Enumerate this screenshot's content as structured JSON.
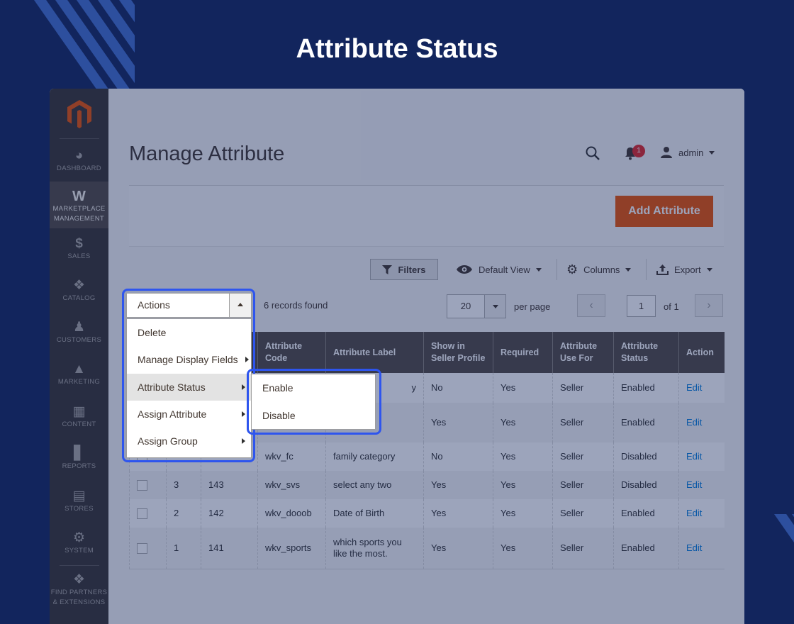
{
  "headline": "Attribute Status",
  "sidebar": {
    "items": [
      {
        "icon": "dashboard-icon",
        "label1": "DASHBOARD",
        "label2": ""
      },
      {
        "icon": "marketplace-icon",
        "label1": "MARKETPLACE",
        "label2": "MANAGEMENT"
      },
      {
        "icon": "sales-icon",
        "label1": "SALES",
        "label2": ""
      },
      {
        "icon": "catalog-icon",
        "label1": "CATALOG",
        "label2": ""
      },
      {
        "icon": "customers-icon",
        "label1": "CUSTOMERS",
        "label2": ""
      },
      {
        "icon": "marketing-icon",
        "label1": "MARKETING",
        "label2": ""
      },
      {
        "icon": "content-icon",
        "label1": "CONTENT",
        "label2": ""
      },
      {
        "icon": "reports-icon",
        "label1": "REPORTS",
        "label2": ""
      },
      {
        "icon": "stores-icon",
        "label1": "STORES",
        "label2": ""
      },
      {
        "icon": "system-icon",
        "label1": "SYSTEM",
        "label2": ""
      },
      {
        "icon": "partners-icon",
        "label1": "FIND PARTNERS",
        "label2": "& EXTENSIONS"
      }
    ]
  },
  "header": {
    "title": "Manage Attribute",
    "notification_count": "1",
    "user": "admin"
  },
  "action_bar": {
    "add_label": "Add Attribute"
  },
  "toolbar": {
    "filters": "Filters",
    "default_view": "Default View",
    "columns": "Columns",
    "export": "Export"
  },
  "grid_controls": {
    "records": "6 records found",
    "per_page_value": "20",
    "per_page_label": "per page",
    "page_value": "1",
    "of_label": "of 1"
  },
  "grid": {
    "headers": [
      "",
      "",
      "",
      "Attribute Code",
      "Attribute Label",
      "Show in Seller Profile",
      "Required",
      "Attribute Use For",
      "Attribute Status",
      "Action"
    ],
    "rows": [
      {
        "id": "",
        "attr_id": "",
        "code": "",
        "label": "y",
        "show": "No",
        "required": "Yes",
        "use_for": "Seller",
        "status": "Enabled",
        "action": "Edit"
      },
      {
        "id": "",
        "attr_id": "",
        "code": "",
        "label": "",
        "show": "Yes",
        "required": "Yes",
        "use_for": "Seller",
        "status": "Enabled",
        "action": "Edit"
      },
      {
        "id": "",
        "attr_id": "",
        "code": "wkv_fc",
        "label": "family category",
        "show": "No",
        "required": "Yes",
        "use_for": "Seller",
        "status": "Disabled",
        "action": "Edit"
      },
      {
        "id": "3",
        "attr_id": "143",
        "code": "wkv_svs",
        "label": "select any two",
        "show": "Yes",
        "required": "Yes",
        "use_for": "Seller",
        "status": "Disabled",
        "action": "Edit"
      },
      {
        "id": "2",
        "attr_id": "142",
        "code": "wkv_dooob",
        "label": "Date of Birth",
        "show": "Yes",
        "required": "Yes",
        "use_for": "Seller",
        "status": "Enabled",
        "action": "Edit"
      },
      {
        "id": "1",
        "attr_id": "141",
        "code": "wkv_sports",
        "label": "which sports you like the most.",
        "show": "Yes",
        "required": "Yes",
        "use_for": "Seller",
        "status": "Enabled",
        "action": "Edit"
      }
    ]
  },
  "actions_menu": {
    "label": "Actions",
    "items": [
      "Delete",
      "Manage Display Fields",
      "Attribute Status",
      "Assign Attribute",
      "Assign Group"
    ],
    "submenu": [
      "Enable",
      "Disable"
    ]
  },
  "colors": {
    "background": "#12255d",
    "highlight": "#2e55ee",
    "accent": "#eb5202",
    "sidebar": "#373330",
    "link": "#007bdb"
  }
}
